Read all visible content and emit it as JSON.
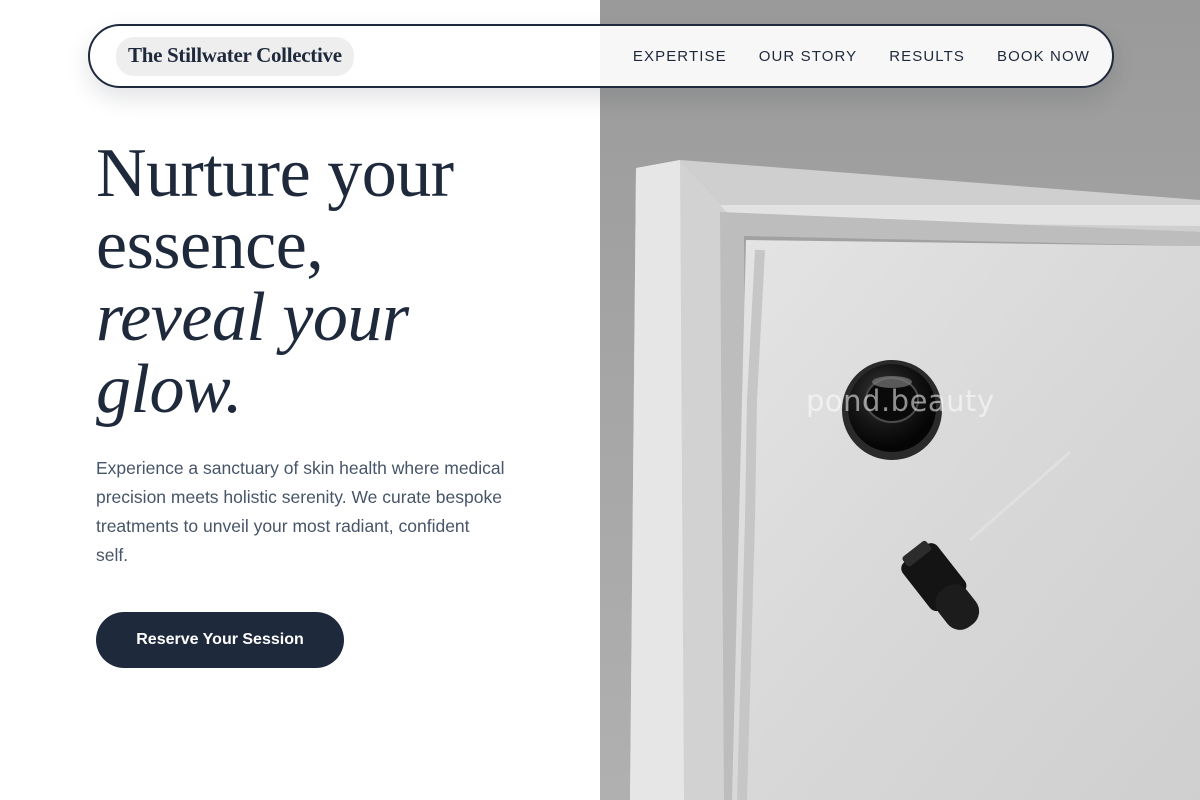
{
  "nav": {
    "brand": "The Stillwater Collective",
    "links": [
      {
        "label": "EXPERTISE"
      },
      {
        "label": "OUR STORY"
      },
      {
        "label": "RESULTS"
      },
      {
        "label": "BOOK NOW"
      }
    ]
  },
  "hero": {
    "title_line1": "Nurture your",
    "title_line2": "essence,",
    "title_line3": "reveal your",
    "title_line4": "glow.",
    "description": "Experience a sanctuary of skin health where medical precision meets holistic serenity. We curate bespoke treatments to unveil your most radiant, confident self.",
    "cta_label": "Reserve Your Session"
  },
  "image": {
    "watermark": "pond.beauty"
  }
}
